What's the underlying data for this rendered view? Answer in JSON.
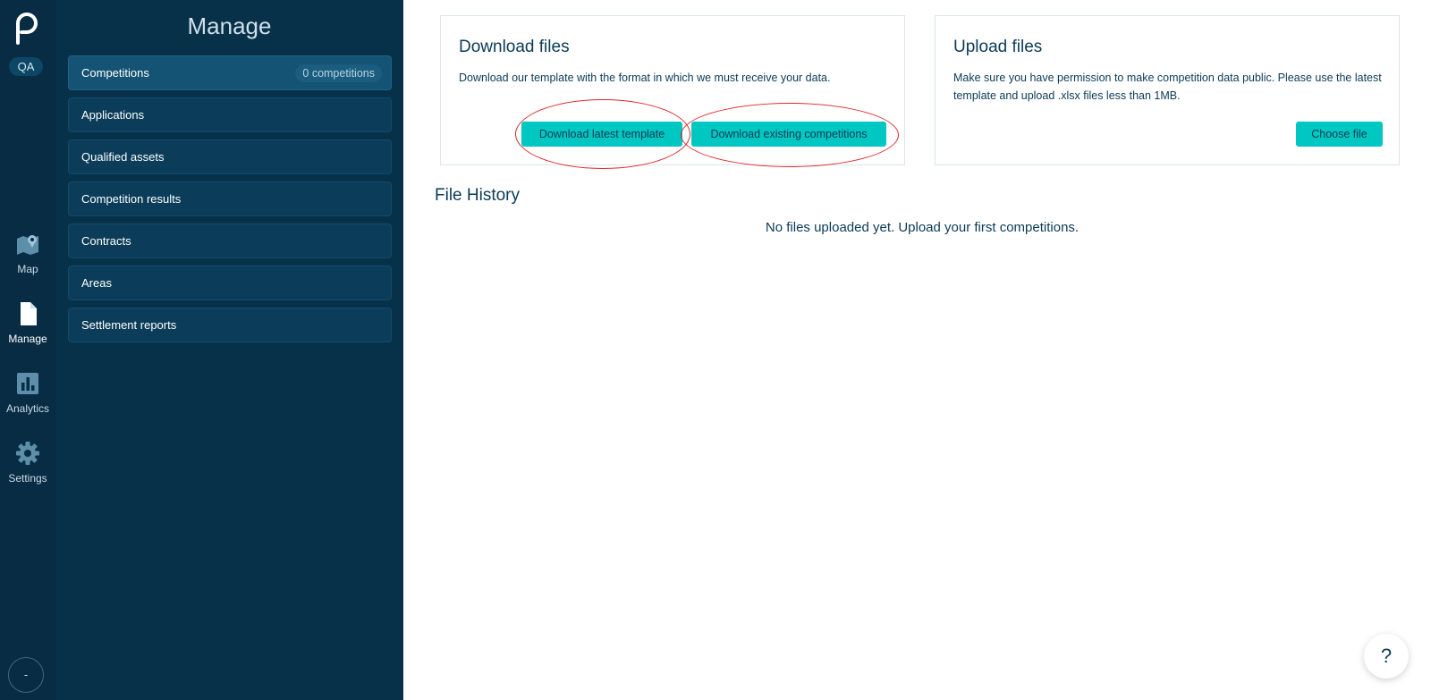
{
  "rail": {
    "env_badge": "QA",
    "items": [
      {
        "label": "Map",
        "icon": "map-icon"
      },
      {
        "label": "Manage",
        "icon": "document-icon"
      },
      {
        "label": "Analytics",
        "icon": "bar-chart-icon"
      },
      {
        "label": "Settings",
        "icon": "gear-icon"
      }
    ],
    "user_initial": "-"
  },
  "manage": {
    "title": "Manage",
    "items": [
      {
        "label": "Competitions",
        "count": "0 competitions"
      },
      {
        "label": "Applications"
      },
      {
        "label": "Qualified assets"
      },
      {
        "label": "Competition results"
      },
      {
        "label": "Contracts"
      },
      {
        "label": "Areas"
      },
      {
        "label": "Settlement reports"
      }
    ]
  },
  "download": {
    "title": "Download files",
    "description": "Download our template with the format in which we must receive your data.",
    "template_button": "Download latest template",
    "existing_button": "Download existing competitions"
  },
  "upload": {
    "title": "Upload files",
    "description": "Make sure you have permission to make competition data public. Please use the latest template and upload .xlsx files less than 1MB.",
    "choose_button": "Choose file"
  },
  "file_history": {
    "title": "File History",
    "empty_message": "No files uploaded yet. Upload your first competitions."
  },
  "help": {
    "label": "?"
  },
  "colors": {
    "rail_bg": "#072c44",
    "panel_bg": "#073049",
    "accent": "#00c7c2",
    "annotation": "#e0262a"
  }
}
